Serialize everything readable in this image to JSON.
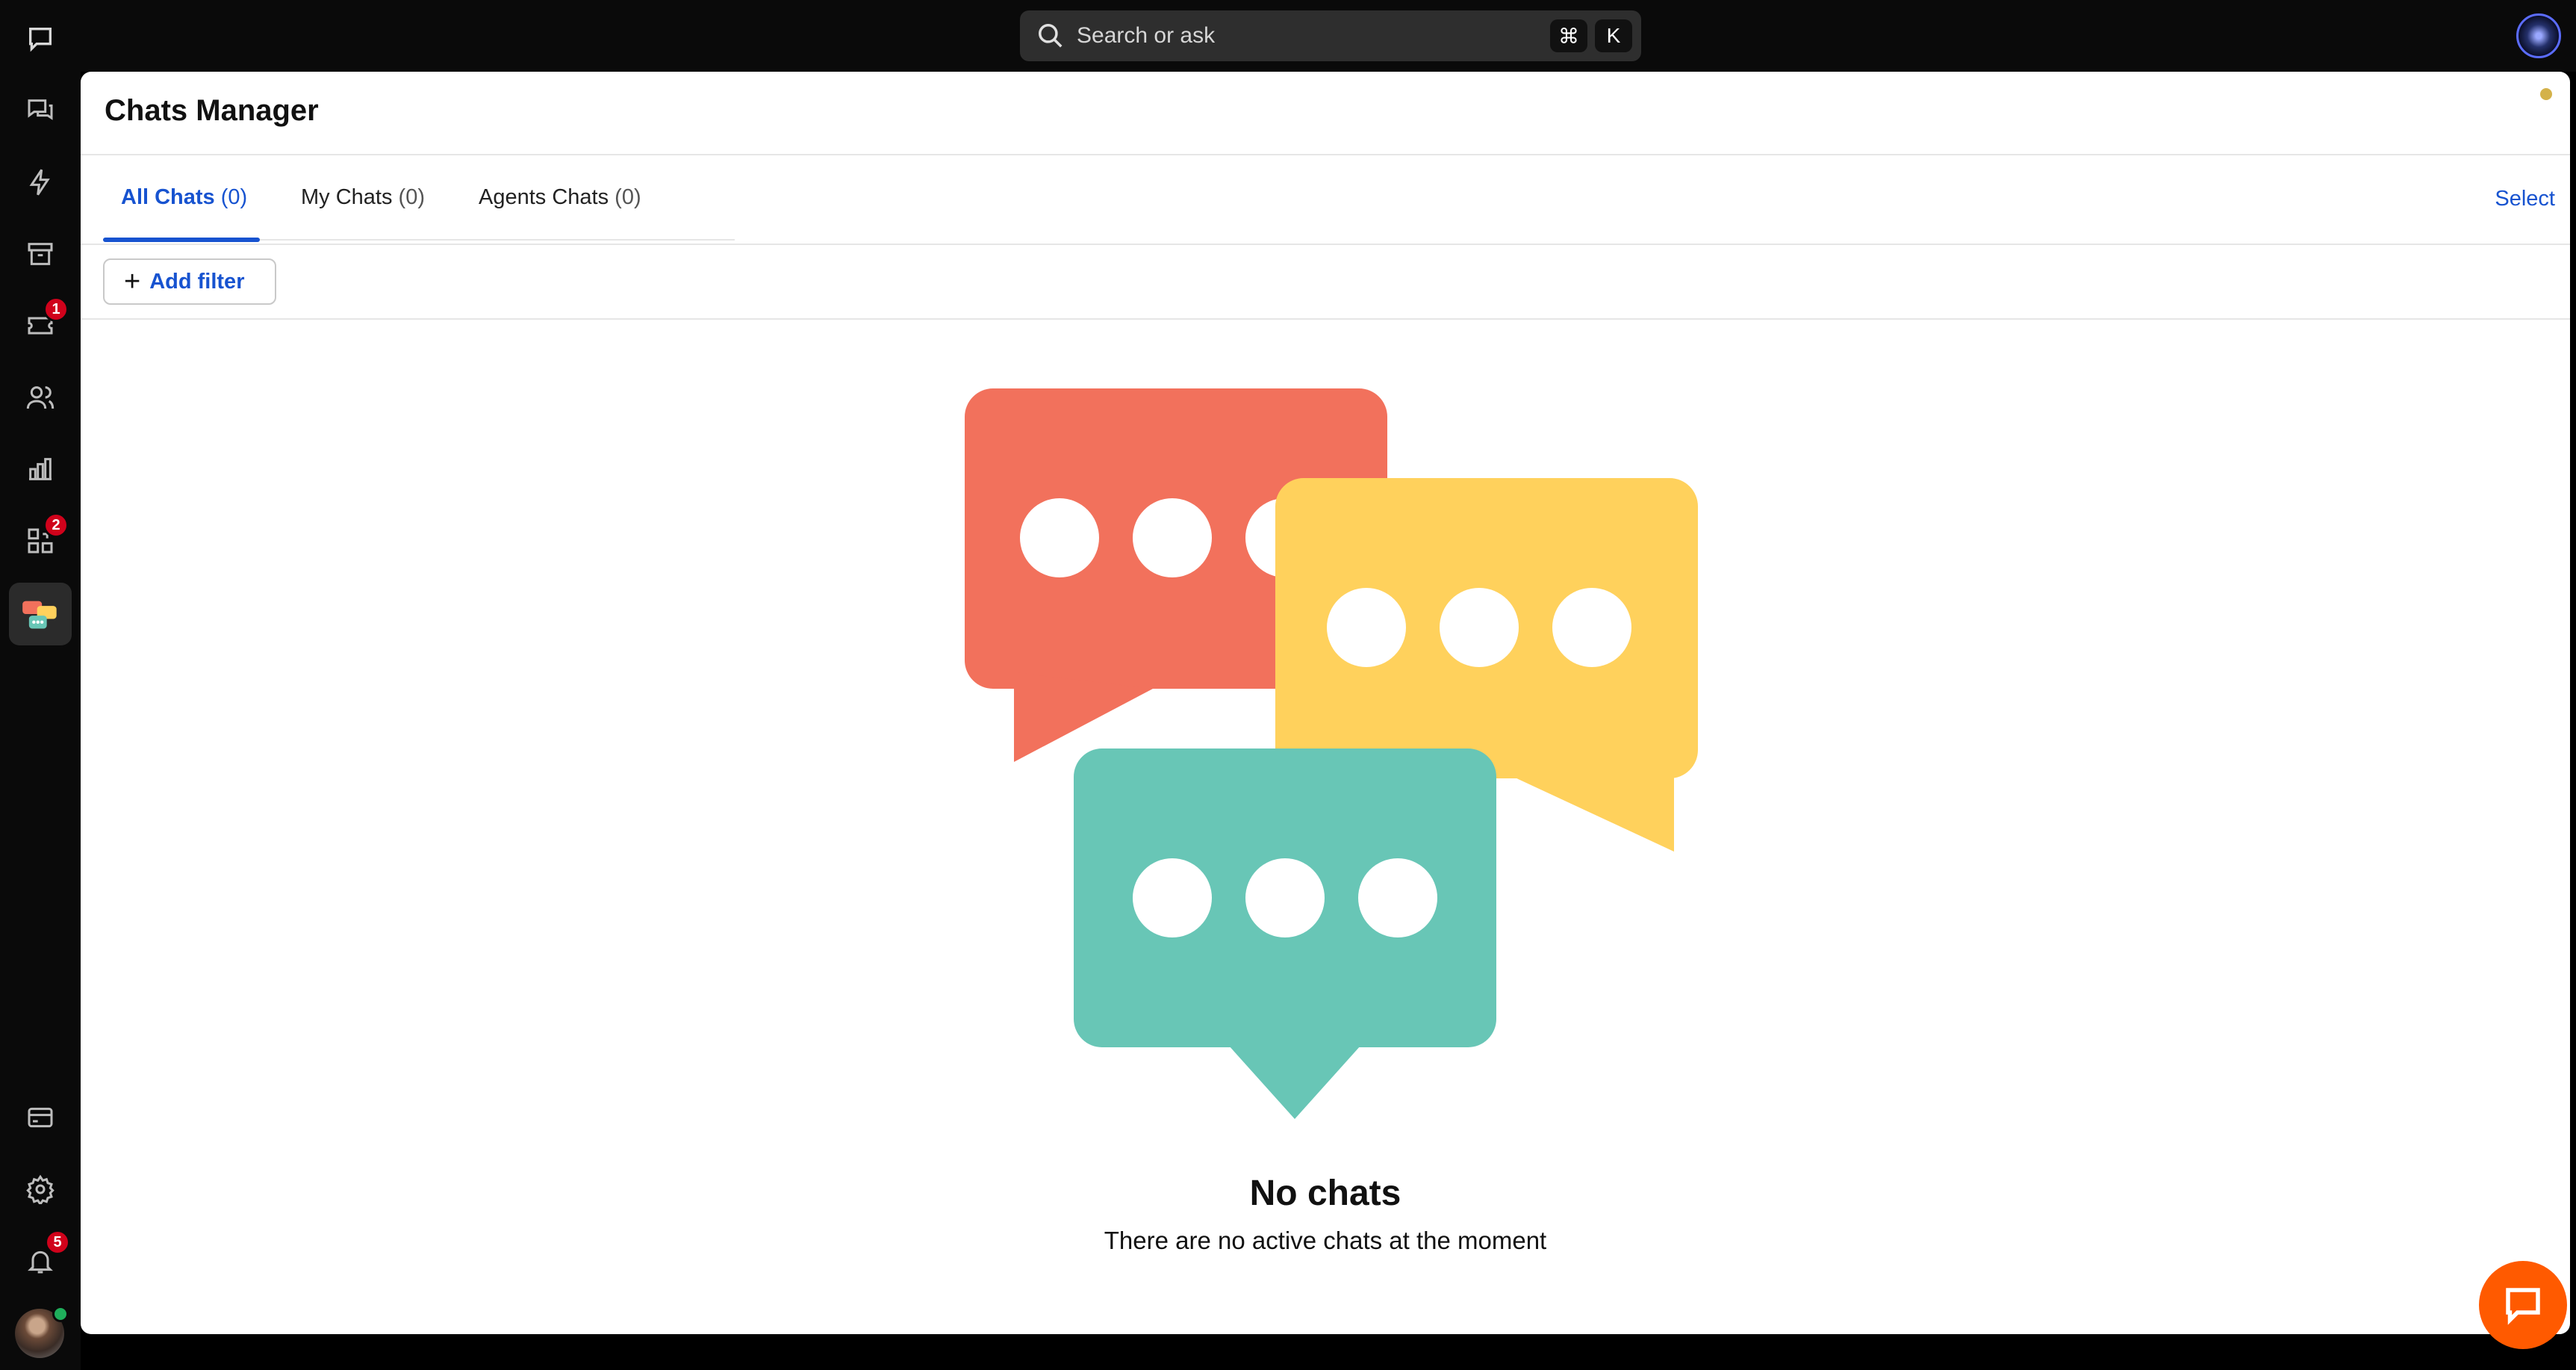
{
  "app": {
    "title": "Chats Manager"
  },
  "search": {
    "placeholder": "Search or ask",
    "shortcut_key_1": "⌘",
    "shortcut_key_2": "K"
  },
  "sidebar": {
    "items": [
      {
        "name": "chats",
        "icon": "chat-bubble-icon"
      },
      {
        "name": "conversations",
        "icon": "messages-icon"
      },
      {
        "name": "automation",
        "icon": "lightning-icon"
      },
      {
        "name": "archives",
        "icon": "archive-icon"
      },
      {
        "name": "tickets",
        "icon": "ticket-icon",
        "badge": "1"
      },
      {
        "name": "customers",
        "icon": "people-icon"
      },
      {
        "name": "reports",
        "icon": "bar-chart-icon"
      },
      {
        "name": "apps",
        "icon": "apps-grid-icon",
        "badge": "2"
      },
      {
        "name": "chats-manager",
        "icon": "chats-manager-icon",
        "active": true
      }
    ],
    "bottom": [
      {
        "name": "billing",
        "icon": "credit-card-icon"
      },
      {
        "name": "settings",
        "icon": "gear-icon"
      },
      {
        "name": "notifications",
        "icon": "bell-icon",
        "badge": "5"
      }
    ]
  },
  "tabs": [
    {
      "label": "All Chats",
      "count": "(0)",
      "active": true
    },
    {
      "label": "My Chats",
      "count": "(0)"
    },
    {
      "label": "Agents Chats",
      "count": "(0)"
    }
  ],
  "toolbar": {
    "select_label": "Select",
    "add_filter_label": "Add filter"
  },
  "empty_state": {
    "title": "No chats",
    "subtitle": "There are no active chats at the moment"
  },
  "colors": {
    "accent": "#1753d0",
    "bubble_red": "#f2715c",
    "bubble_yellow": "#ffd15c",
    "bubble_teal": "#68c6b6",
    "launcher": "#ff5a00",
    "badge": "#d0021b"
  }
}
